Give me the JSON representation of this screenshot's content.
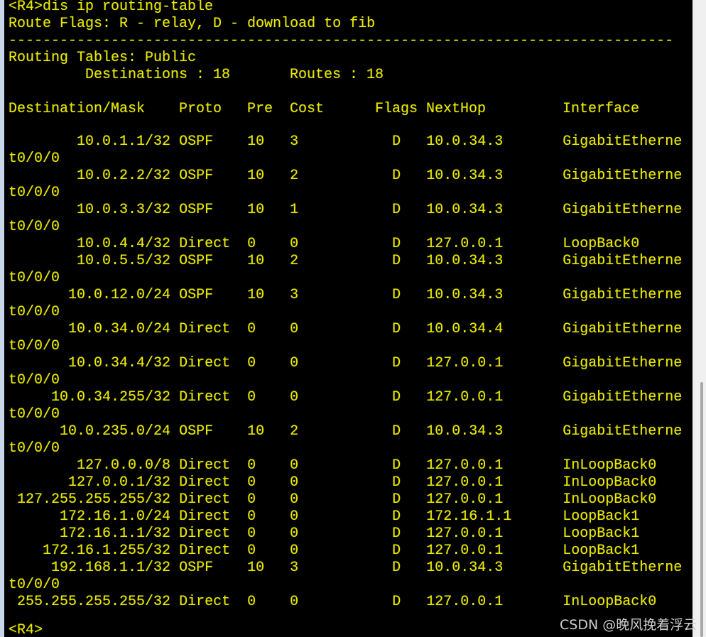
{
  "terminal": {
    "command_line": "<R4>dis ip routing-table",
    "flags_legend": "Route Flags: R - relay, D - download to fib",
    "separator": "------------------------------------------------------------------------------",
    "table_name": "Routing Tables: Public",
    "destinations_label": "Destinations : 18",
    "routes_label": "Routes : 18",
    "headers": {
      "dest": "Destination/Mask",
      "proto": "Proto",
      "pre": "Pre",
      "cost": "Cost",
      "flags": "Flags",
      "nexthop": "NextHop",
      "interface": "Interface"
    },
    "routes": [
      {
        "dest": "10.0.1.1/32",
        "proto": "OSPF",
        "pre": "10",
        "cost": "3",
        "flags": "D",
        "nexthop": "10.0.34.3",
        "interface": "GigabitEthernet0/0/0"
      },
      {
        "dest": "10.0.2.2/32",
        "proto": "OSPF",
        "pre": "10",
        "cost": "2",
        "flags": "D",
        "nexthop": "10.0.34.3",
        "interface": "GigabitEthernet0/0/0"
      },
      {
        "dest": "10.0.3.3/32",
        "proto": "OSPF",
        "pre": "10",
        "cost": "1",
        "flags": "D",
        "nexthop": "10.0.34.3",
        "interface": "GigabitEthernet0/0/0"
      },
      {
        "dest": "10.0.4.4/32",
        "proto": "Direct",
        "pre": "0",
        "cost": "0",
        "flags": "D",
        "nexthop": "127.0.0.1",
        "interface": "LoopBack0"
      },
      {
        "dest": "10.0.5.5/32",
        "proto": "OSPF",
        "pre": "10",
        "cost": "2",
        "flags": "D",
        "nexthop": "10.0.34.3",
        "interface": "GigabitEthernet0/0/0"
      },
      {
        "dest": "10.0.12.0/24",
        "proto": "OSPF",
        "pre": "10",
        "cost": "3",
        "flags": "D",
        "nexthop": "10.0.34.3",
        "interface": "GigabitEthernet0/0/0"
      },
      {
        "dest": "10.0.34.0/24",
        "proto": "Direct",
        "pre": "0",
        "cost": "0",
        "flags": "D",
        "nexthop": "10.0.34.4",
        "interface": "GigabitEthernet0/0/0"
      },
      {
        "dest": "10.0.34.4/32",
        "proto": "Direct",
        "pre": "0",
        "cost": "0",
        "flags": "D",
        "nexthop": "127.0.0.1",
        "interface": "GigabitEthernet0/0/0"
      },
      {
        "dest": "10.0.34.255/32",
        "proto": "Direct",
        "pre": "0",
        "cost": "0",
        "flags": "D",
        "nexthop": "127.0.0.1",
        "interface": "GigabitEthernet0/0/0"
      },
      {
        "dest": "10.0.235.0/24",
        "proto": "OSPF",
        "pre": "10",
        "cost": "2",
        "flags": "D",
        "nexthop": "10.0.34.3",
        "interface": "GigabitEthernet0/0/0"
      },
      {
        "dest": "127.0.0.0/8",
        "proto": "Direct",
        "pre": "0",
        "cost": "0",
        "flags": "D",
        "nexthop": "127.0.0.1",
        "interface": "InLoopBack0"
      },
      {
        "dest": "127.0.0.1/32",
        "proto": "Direct",
        "pre": "0",
        "cost": "0",
        "flags": "D",
        "nexthop": "127.0.0.1",
        "interface": "InLoopBack0"
      },
      {
        "dest": "127.255.255.255/32",
        "proto": "Direct",
        "pre": "0",
        "cost": "0",
        "flags": "D",
        "nexthop": "127.0.0.1",
        "interface": "InLoopBack0"
      },
      {
        "dest": "172.16.1.0/24",
        "proto": "Direct",
        "pre": "0",
        "cost": "0",
        "flags": "D",
        "nexthop": "172.16.1.1",
        "interface": "LoopBack1"
      },
      {
        "dest": "172.16.1.1/32",
        "proto": "Direct",
        "pre": "0",
        "cost": "0",
        "flags": "D",
        "nexthop": "127.0.0.1",
        "interface": "LoopBack1"
      },
      {
        "dest": "172.16.1.255/32",
        "proto": "Direct",
        "pre": "0",
        "cost": "0",
        "flags": "D",
        "nexthop": "127.0.0.1",
        "interface": "LoopBack1"
      },
      {
        "dest": "192.168.1.1/32",
        "proto": "OSPF",
        "pre": "10",
        "cost": "3",
        "flags": "D",
        "nexthop": "10.0.34.3",
        "interface": "GigabitEthernet0/0/0"
      },
      {
        "dest": "255.255.255.255/32",
        "proto": "Direct",
        "pre": "0",
        "cost": "0",
        "flags": "D",
        "nexthop": "127.0.0.1",
        "interface": "InLoopBack0"
      }
    ],
    "prompt": "<R4>"
  },
  "watermark": "CSDN @晚风挽着浮云"
}
